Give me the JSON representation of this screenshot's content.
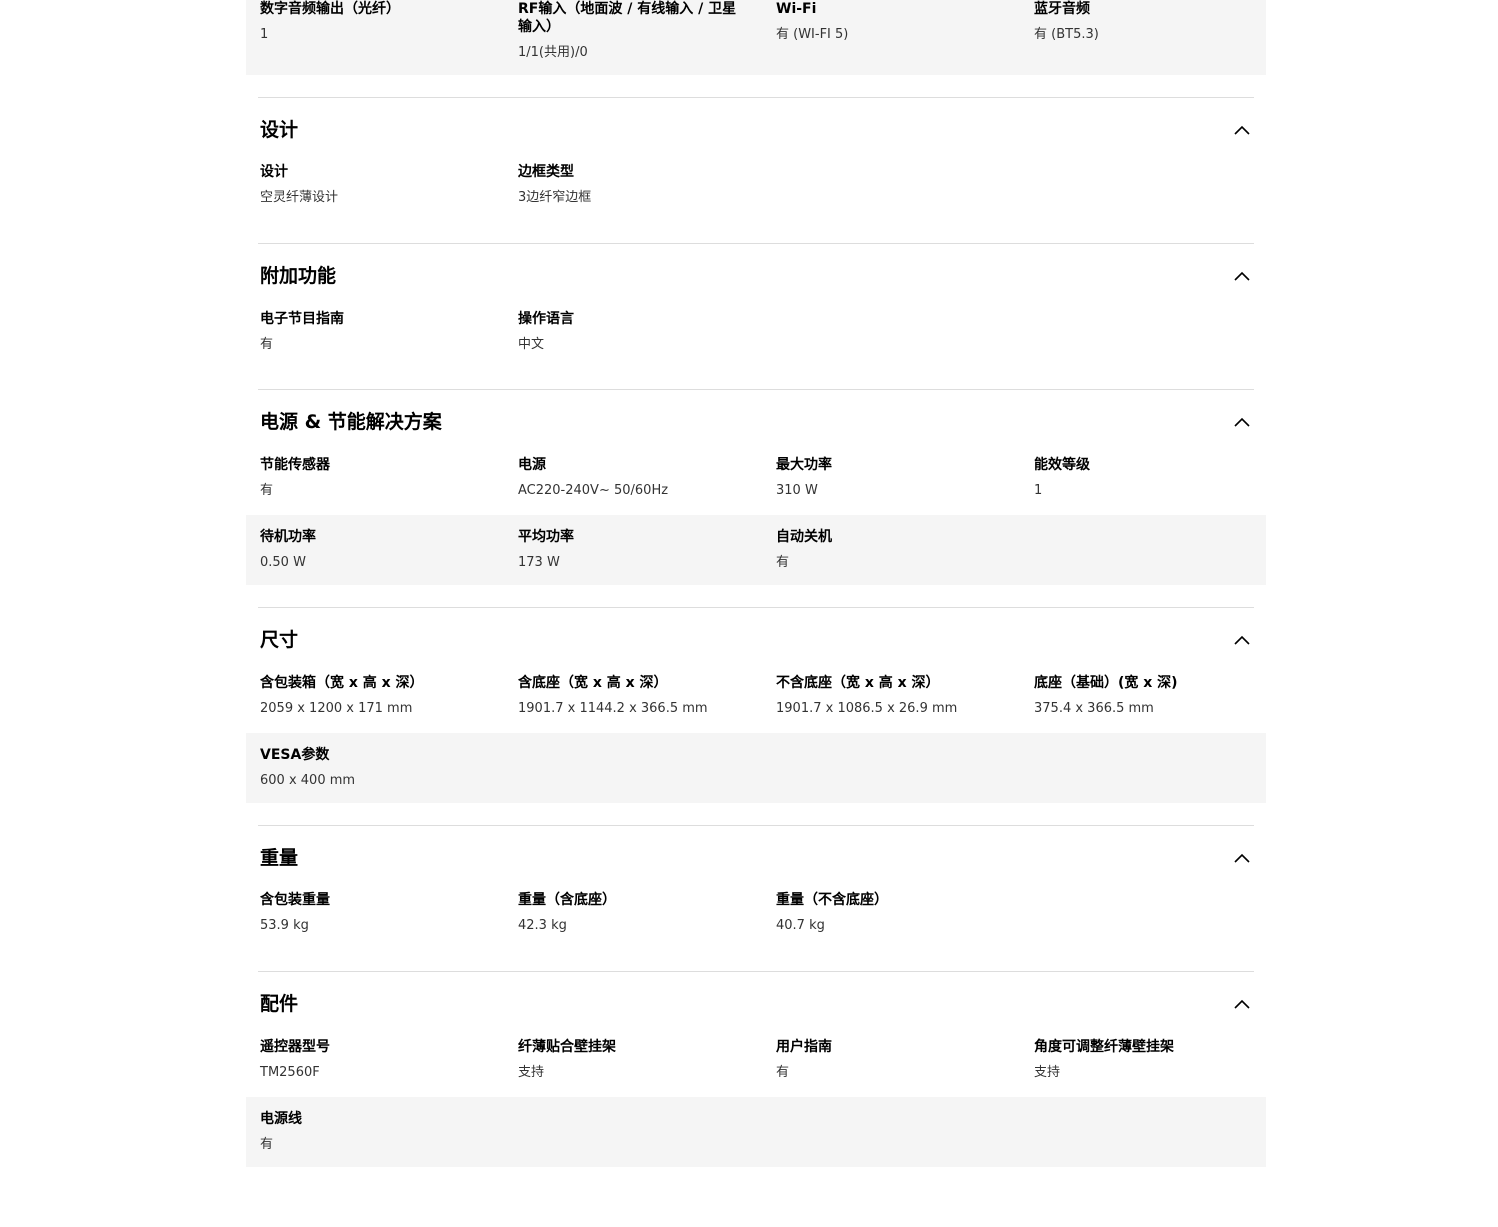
{
  "top_continuation": {
    "items": [
      {
        "label": "数字音频输出（光纤）",
        "value": "1"
      },
      {
        "label": "RF输入（地面波 / 有线输入 / 卫星输入）",
        "value": "1/1(共用)/0"
      },
      {
        "label": "Wi-Fi",
        "value": "有 (WI-FI 5)"
      },
      {
        "label": "蓝牙音频",
        "value": "有 (BT5.3)"
      }
    ]
  },
  "sections": {
    "design": {
      "title": "设计",
      "items": [
        {
          "label": "设计",
          "value": "空灵纤薄设计"
        },
        {
          "label": "边框类型",
          "value": "3边纤窄边框"
        }
      ]
    },
    "features": {
      "title": "附加功能",
      "items": [
        {
          "label": "电子节目指南",
          "value": "有"
        },
        {
          "label": "操作语言",
          "value": "中文"
        }
      ]
    },
    "power": {
      "title": "电源 & 节能解决方案",
      "items": [
        {
          "label": "节能传感器",
          "value": "有"
        },
        {
          "label": "电源",
          "value": "AC220-240V~ 50/60Hz"
        },
        {
          "label": "最大功率",
          "value": "310 W"
        },
        {
          "label": "能效等级",
          "value": "1"
        },
        {
          "label": "待机功率",
          "value": "0.50 W"
        },
        {
          "label": "平均功率",
          "value": "173 W"
        },
        {
          "label": "自动关机",
          "value": "有"
        }
      ]
    },
    "dimensions": {
      "title": "尺寸",
      "items": [
        {
          "label": "含包装箱（宽 x 高 x 深）",
          "value": "2059 x 1200 x 171 mm"
        },
        {
          "label": "含底座（宽 x 高 x 深）",
          "value": "1901.7 x 1144.2 x 366.5 mm"
        },
        {
          "label": "不含底座（宽 x 高 x 深）",
          "value": "1901.7 x 1086.5 x 26.9 mm"
        },
        {
          "label": "底座（基础）(宽 x 深)",
          "value": "375.4 x 366.5 mm"
        },
        {
          "label": "VESA参数",
          "value": "600 x 400 mm"
        }
      ]
    },
    "weight": {
      "title": "重量",
      "items": [
        {
          "label": "含包装重量",
          "value": "53.9 kg"
        },
        {
          "label": "重量（含底座）",
          "value": "42.3 kg"
        },
        {
          "label": "重量（不含底座）",
          "value": "40.7 kg"
        }
      ]
    },
    "accessories": {
      "title": "配件",
      "items": [
        {
          "label": "遥控器型号",
          "value": "TM2560F"
        },
        {
          "label": "纤薄贴合壁挂架",
          "value": "支持"
        },
        {
          "label": "用户指南",
          "value": "有"
        },
        {
          "label": "角度可调整纤薄壁挂架",
          "value": "支持"
        },
        {
          "label": "电源线",
          "value": "有"
        }
      ]
    }
  },
  "icons": {
    "collapse": "chevron-up-icon"
  },
  "colors": {
    "shaded_row": "#f5f5f5",
    "divider": "#dddddd",
    "text": "#000000",
    "value_text": "#333333"
  }
}
